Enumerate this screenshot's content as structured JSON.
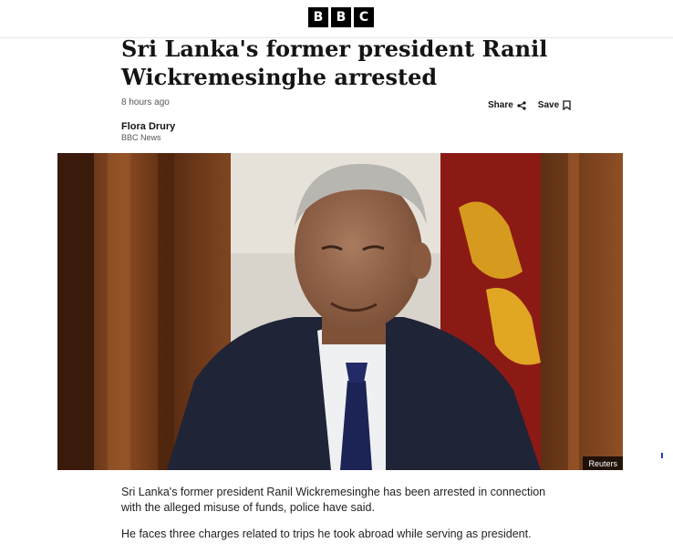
{
  "brand": {
    "logo_letters": [
      "B",
      "B",
      "C"
    ]
  },
  "article": {
    "headline": "Sri Lanka's former president Ranil Wickremesinghe arrested",
    "timestamp": "8 hours ago",
    "author": "Flora Drury",
    "outlet": "BBC News",
    "paragraphs": [
      "Sri Lanka's former president Ranil Wickremesinghe has been arrested in connection with the alleged misuse of funds, police have said.",
      "He faces three charges related to trips he took abroad while serving as president."
    ]
  },
  "actions": {
    "share_label": "Share",
    "share_icon": "share-icon",
    "save_label": "Save",
    "save_icon": "bookmark-icon"
  },
  "image": {
    "credit": "Reuters"
  },
  "colors": {
    "logo_bg": "#000000",
    "headline": "#141414",
    "meta": "#545658",
    "credit_bg": "#000000"
  }
}
